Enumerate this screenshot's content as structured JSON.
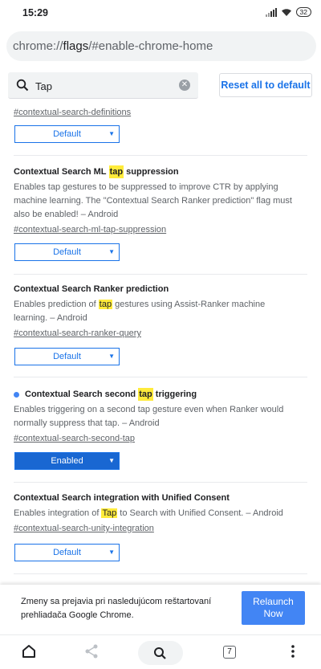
{
  "status_bar": {
    "time": "15:29",
    "battery": "32"
  },
  "url_bar": {
    "prefix": "chrome://",
    "host": "flags",
    "path": "/#enable-chrome-home"
  },
  "search": {
    "value": "Tap"
  },
  "reset_button": {
    "label": "Reset all to default"
  },
  "flags": [
    {
      "link": "#contextual-search-definitions",
      "select": "Default"
    },
    {
      "title_before": "Contextual Search ML ",
      "title_highlight": "tap",
      "title_after": " suppression",
      "desc_1": "Enables tap gestures to be suppressed to improve CTR by applying",
      "desc_2": "machine learning. The \"Contextual Search Ranker prediction\" flag must",
      "desc_3": "also be enabled! – Android",
      "link": "#contextual-search-ml-tap-suppression",
      "select": "Default"
    },
    {
      "title": "Contextual Search Ranker prediction",
      "desc_before": "Enables prediction of ",
      "desc_highlight": "tap",
      "desc_after": " gestures using Assist-Ranker machine",
      "desc_2": "learning. – Android",
      "link": "#contextual-search-ranker-query",
      "select": "Default"
    },
    {
      "title_before": "Contextual Search second ",
      "title_highlight": "tap",
      "title_after": " triggering",
      "desc_1": "Enables triggering on a second tap gesture even when Ranker would",
      "desc_2": "normally suppress that tap. – Android",
      "link": "#contextual-search-second-tap",
      "select": "Enabled"
    },
    {
      "title": "Contextual Search integration with Unified Consent",
      "desc_before": "Enables integration of ",
      "desc_highlight": "Tap",
      "desc_after": " to Search with Unified Consent. – Android",
      "link": "#contextual-search-unity-integration",
      "select": "Default"
    }
  ],
  "notice": {
    "line_1": "Zmeny sa prejavia pri nasledujúcom reštartovaní",
    "line_2": "prehliadača Google Chrome.",
    "relaunch_1": "Relaunch",
    "relaunch_2": "Now"
  },
  "bottom_bar": {
    "tab_count": "7"
  },
  "colors": {
    "accent": "#1a73e8",
    "enabled_bg": "#1967d2",
    "highlight": "#ffeb3b",
    "relaunch_bg": "#4285f4"
  }
}
